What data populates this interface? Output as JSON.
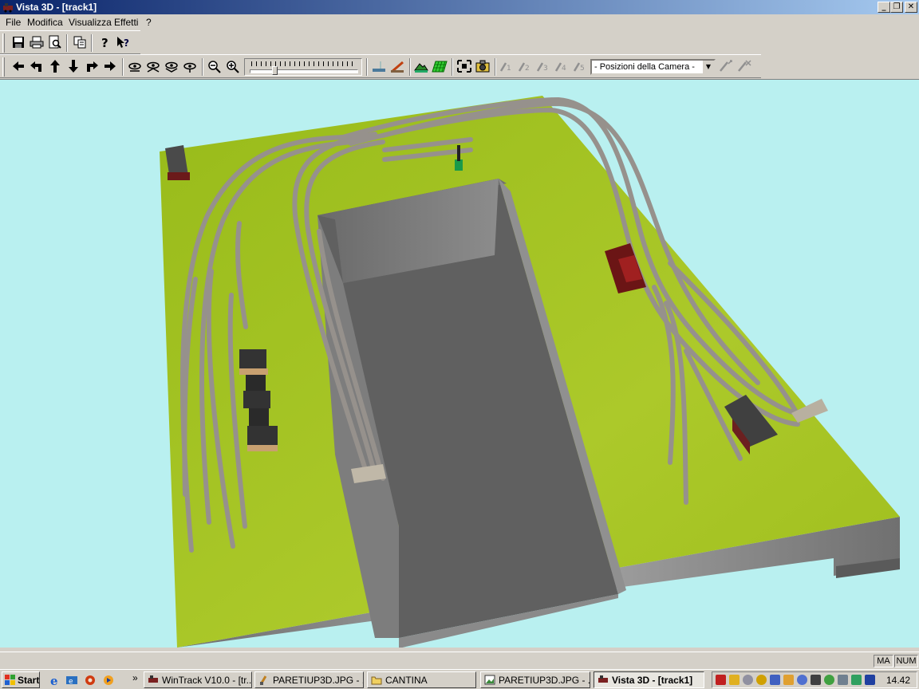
{
  "window": {
    "title": "Vista 3D - [track1]",
    "btn_min": "_",
    "btn_max": "❐",
    "btn_close": "✕"
  },
  "menu": {
    "file": "File",
    "edit": "Modifica",
    "view": "Visualizza",
    "effects": "Effetti",
    "help": "?"
  },
  "toolbar2": {
    "camera_combo": "- Posizioni della Camera -",
    "combo_arrow": "▼"
  },
  "status": {
    "caps": "MA",
    "num": "NUM"
  },
  "taskbar": {
    "start": "Start",
    "chevron": "»",
    "tasks": [
      {
        "label": "WinTrack  V10.0 - [tr..."
      },
      {
        "label": "PARETIUP3D.JPG - ..."
      },
      {
        "label": "CANTINA"
      },
      {
        "label": "PARETIUP3D.JPG - ..."
      },
      {
        "label": "Vista 3D - [track1]"
      }
    ],
    "clock": "14.42"
  },
  "colors": {
    "sky": "#b9f0f0",
    "grass": "#a6c621",
    "wall": "#8a8a8a",
    "pit": "#5f5f5f",
    "track": "#9a9590",
    "title_start": "#0a246a",
    "title_end": "#a6caf0"
  }
}
